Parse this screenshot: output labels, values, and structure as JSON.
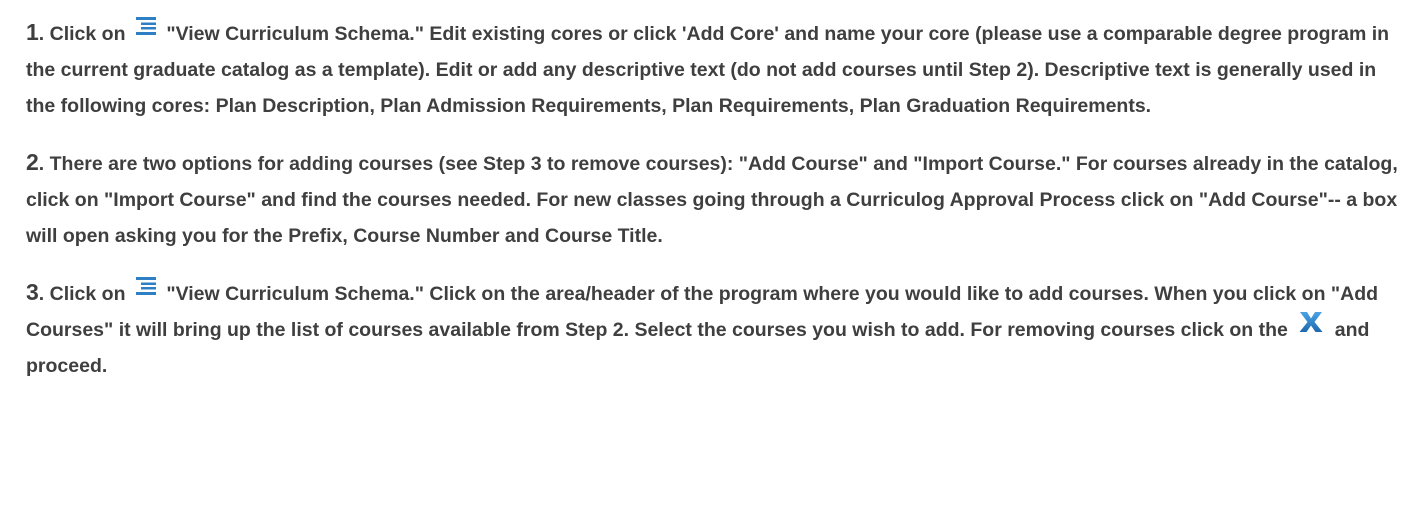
{
  "steps": [
    {
      "number": "1",
      "number_suffix": ". ",
      "segments": [
        {
          "type": "text",
          "text": "Click on "
        },
        {
          "type": "icon",
          "icon": "list-icon"
        },
        {
          "type": "text",
          "text": " \"View Curriculum Schema.\" Edit existing cores or click 'Add Core' and name your core (please use a comparable degree program in the current graduate catalog as a template). Edit or add any descriptive text (do not add courses until Step 2). Descriptive text is generally used in the following cores: Plan Description, Plan Admission Requirements, Plan Requirements, Plan Graduation Requirements."
        }
      ]
    },
    {
      "number": "2",
      "number_suffix": ". ",
      "segments": [
        {
          "type": "text",
          "text": "There are two options for adding courses (see Step 3 to remove courses): \"Add Course\" and \"Import Course.\" For courses already in the catalog, click on \"Import Course\" and find the courses needed. For new classes going through a Curriculog Approval Process click on \"Add Course\"-- a box will open asking you for the Prefix, Course Number and Course Title."
        }
      ]
    },
    {
      "number": "3",
      "number_suffix": ". ",
      "segments": [
        {
          "type": "text",
          "text": "Click on "
        },
        {
          "type": "icon",
          "icon": "list-icon"
        },
        {
          "type": "text",
          "text": " \"View Curriculum Schema.\" Click on the area/header of the program where you would like to add courses. When you click on \"Add Courses\" it will bring up the list of courses available from Step 2. Select the courses you wish to add. For removing courses click on the "
        },
        {
          "type": "icon",
          "icon": "x-icon"
        },
        {
          "type": "text",
          "text": " and proceed."
        }
      ]
    }
  ],
  "colors": {
    "text": "#3f3f3f",
    "icon": "#2f7fc4"
  }
}
